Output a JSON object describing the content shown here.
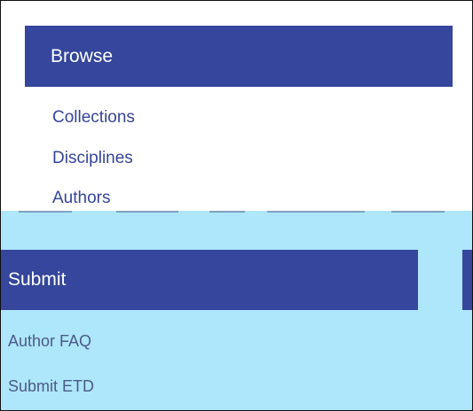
{
  "browse": {
    "title": "Browse",
    "links": [
      {
        "label": "Collections"
      },
      {
        "label": "Disciplines"
      },
      {
        "label": "Authors"
      }
    ]
  },
  "submit": {
    "title": "Submit",
    "links": [
      {
        "label": "Author FAQ"
      },
      {
        "label": "Submit ETD"
      }
    ]
  },
  "colors": {
    "header_bg": "#35469c",
    "link": "#36459b",
    "overlay_bg": "#aee6fb",
    "overlay_link": "#4b5b8a"
  }
}
